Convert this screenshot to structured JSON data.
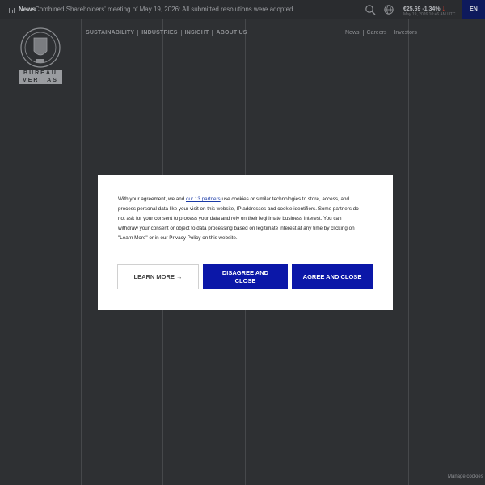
{
  "topbar": {
    "news_label": "News",
    "news_text": "Combined Shareholders' meeting of May 19, 2026: All submitted resolutions were adopted",
    "stock_price": "€25.69",
    "stock_change": "-1.34%",
    "stock_time": "May 19, 2026 10:46 AM UTC",
    "language": "EN"
  },
  "logo": {
    "name_line1": "BUREAU",
    "name_line2": "VERITAS"
  },
  "nav": {
    "items": [
      "SUSTAINABILITY",
      "INDUSTRIES",
      "INSIGHT",
      "ABOUT US"
    ],
    "sub_items": [
      "News",
      "Careers",
      "Investors"
    ]
  },
  "cookie_modal": {
    "text_before_link": "With your agreement, we and ",
    "link_text": "our 13 partners",
    "text_after_link": " use cookies or similar technologies to store, access, and process personal data like your visit on this website, IP addresses and cookie identifiers. Some partners do not ask for your consent to process your data and rely on their legitimate business interest. You can withdraw your consent or object to data processing based on legitimate interest at any time by clicking on \"Learn More\" or in our Privacy Policy on this website.",
    "learn_more_label": "LEARN MORE →",
    "disagree_label": "DISAGREE AND CLOSE",
    "agree_label": "AGREE AND CLOSE"
  },
  "footer": {
    "manage_cookies": "Manage cookies"
  },
  "colors": {
    "background": "#2e3033",
    "button_blue": "#0b17a8",
    "lang_bg": "#0e1a5c",
    "stock_down": "#c0392b"
  }
}
